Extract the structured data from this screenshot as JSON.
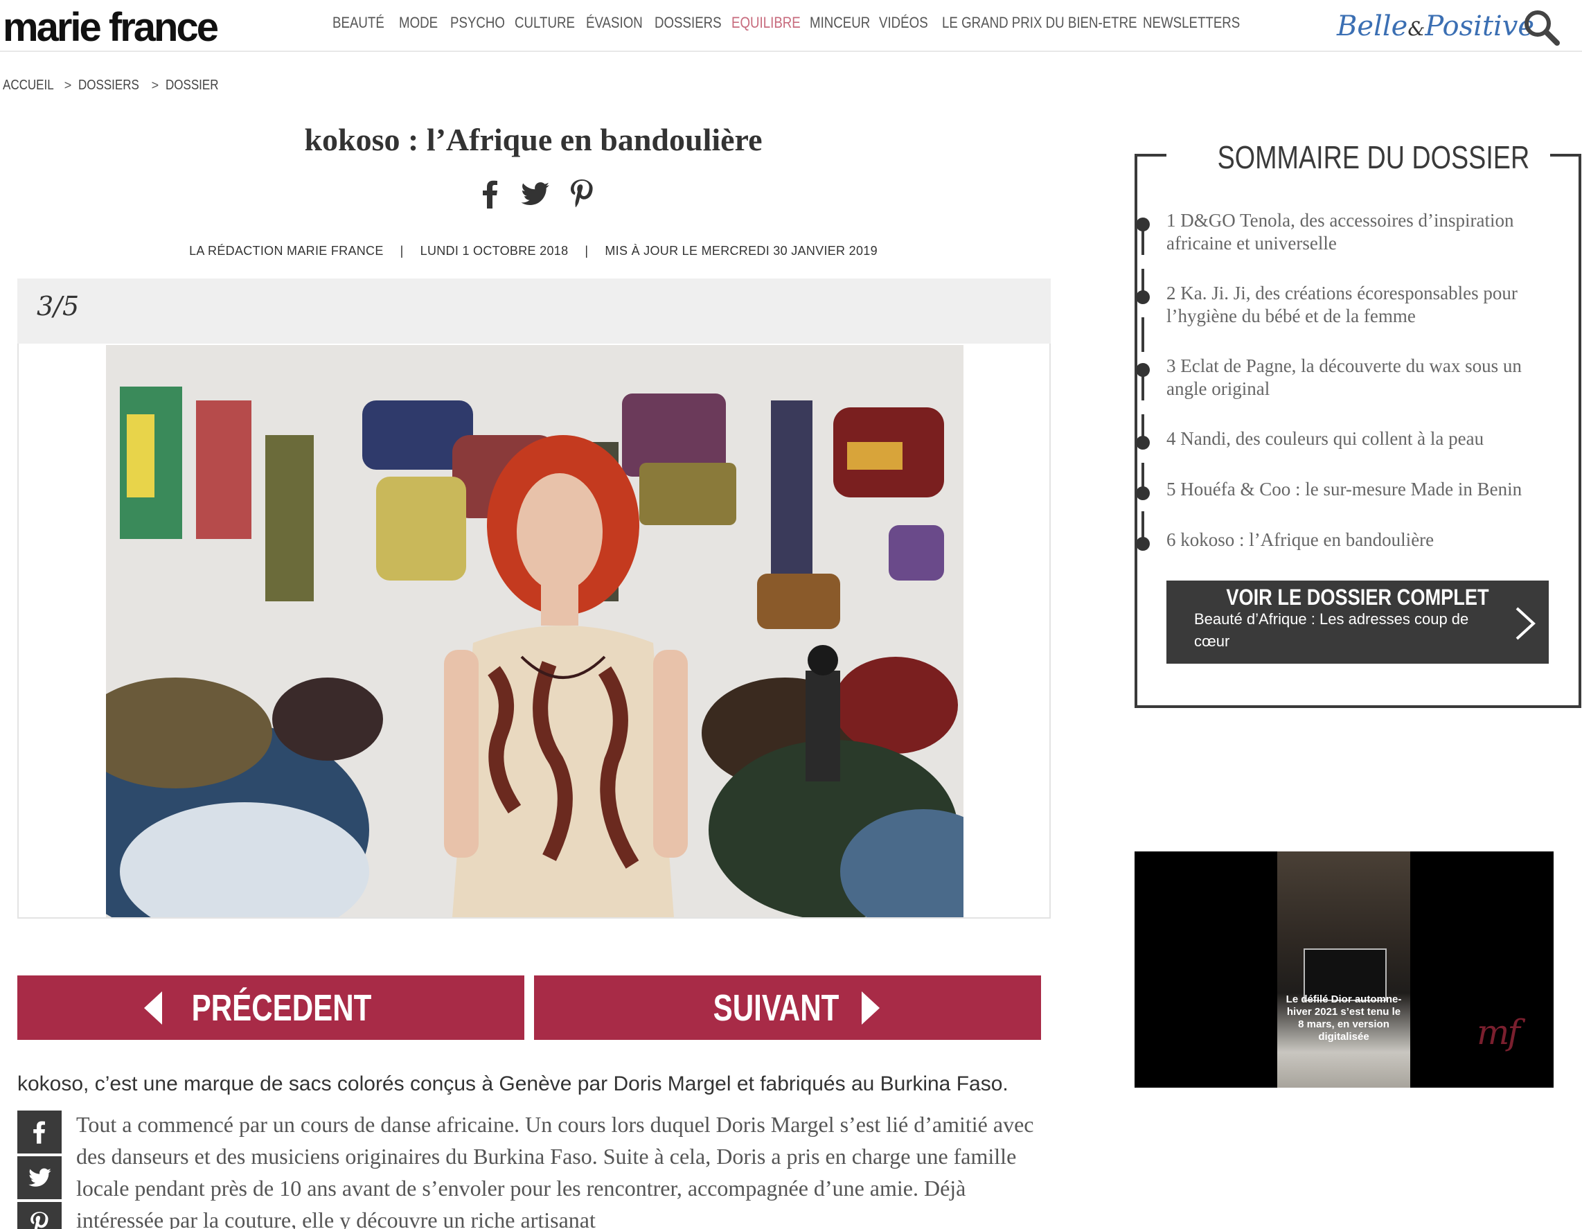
{
  "header": {
    "logo": "marie france",
    "nav": [
      "BEAUTÉ",
      "MODE",
      "PSYCHO",
      "CULTURE",
      "ÉVASION",
      "DOSSIERS",
      "EQUILIBRE",
      "MINCEUR",
      "VIDÉOS",
      "LE GRAND PRIX DU BIEN-ETRE",
      "NEWSLETTERS"
    ],
    "active_nav": "EQUILIBRE",
    "partner_logo_part1": "Belle",
    "partner_logo_amp": "&",
    "partner_logo_part2": "Positive",
    "active_color": "#c76a7c"
  },
  "breadcrumb": [
    "ACCUEIL",
    "DOSSIERS",
    "DOSSIER"
  ],
  "article": {
    "title": "kokoso : l’Afrique en bandoulière",
    "author": "LA RÉDACTION MARIE FRANCE",
    "date": "LUNDI 1 OCTOBRE 2018",
    "updated": "MIS À JOUR LE MERCREDI 30 JANVIER 2019",
    "byline_sep": "|",
    "slide_counter": "3/5",
    "prev_label": "PRÉCEDENT",
    "next_label": "SUIVANT",
    "lead": "kokoso, c’est une marque de sacs colorés conçus à Genève par Doris Margel et fabriqués au Burkina Faso.",
    "body": "Tout a commencé par un cours de danse africaine. Un cours lors duquel Doris Margel s’est lié d’amitié avec des danseurs et des musiciens originaires du Burkina Faso. Suite à cela, Doris a pris en charge une famille locale pendant près de 10 ans avant de s’envoler pour les rencontrer, accompagnée d’une amie. Déjà intéressée par la couture, elle y découvre un riche artisanat",
    "button_color": "#a82b47"
  },
  "sommaire": {
    "title": "SOMMAIRE DU DOSSIER",
    "items": [
      "1 D&GO Tenola, des accessoires d’inspiration africaine et universelle",
      "2 Ka. Ji. Ji, des créations écoresponsables pour l’hygiène du bébé et de la femme",
      "3 Eclat de Pagne, la découverte du wax sous un angle original",
      "4 Nandi, des couleurs qui collent à la peau",
      "5 Houéfa & Coo : le sur-mesure Made in Benin",
      "6 kokoso : l’Afrique en bandoulière"
    ],
    "cta_title": "VOIR LE DOSSIER COMPLET",
    "cta_subtitle": "Beauté d’Afrique : Les adresses coup de cœur"
  },
  "ad": {
    "caption": "Le défilé Dior automne-hiver 2021 s’est tenu le 8 mars, en version digitalisée",
    "brand": "mf"
  }
}
